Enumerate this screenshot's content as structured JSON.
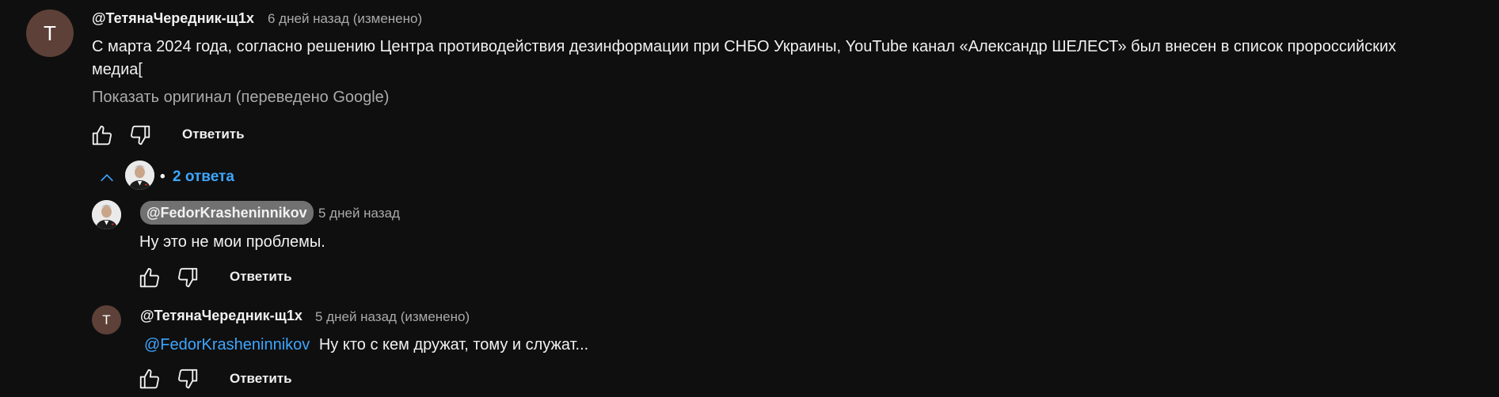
{
  "comment": {
    "avatar_letter": "T",
    "author": "@ТетянаЧередник-щ1х",
    "meta": "6 дней назад (изменено)",
    "text_line1": "С марта 2024 года, согласно решению Центра противодействия дезинформации при СНБО Украины, YouTube канал «Александр ШЕЛЕСТ» был внесен в список пророссийских",
    "text_line2": "медиа[",
    "show_original": "Показать оригинал (переведено Google)",
    "reply_label": "Ответить"
  },
  "replies_toggle": {
    "separator": "•",
    "count_label": "2 ответа"
  },
  "replies": [
    {
      "author": "@FedorKrasheninnikov",
      "meta": "5 дней назад",
      "text": "Ну это не мои проблемы.",
      "reply_label": "Ответить"
    },
    {
      "avatar_letter": "T",
      "author": "@ТетянаЧередник-щ1х",
      "meta": "5 дней назад (изменено)",
      "mention": "@FedorKrasheninnikov",
      "text": "Ну кто с кем дружат, тому и служат...",
      "reply_label": "Ответить"
    }
  ],
  "colors": {
    "background": "#0f0f0f",
    "link": "#3ea6ff",
    "avatar_letter_bg": "#5d4037",
    "owner_chip_bg": "#717171"
  }
}
